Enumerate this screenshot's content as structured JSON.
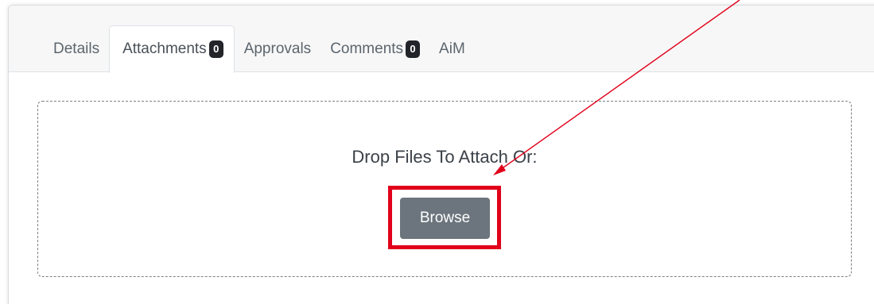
{
  "tabs": [
    {
      "label": "Details",
      "badge": null,
      "active": false
    },
    {
      "label": "Attachments",
      "badge": "0",
      "active": true
    },
    {
      "label": "Approvals",
      "badge": null,
      "active": false
    },
    {
      "label": "Comments",
      "badge": "0",
      "active": false
    },
    {
      "label": "AiM",
      "badge": null,
      "active": false
    }
  ],
  "dropzone": {
    "text": "Drop Files To Attach Or:",
    "browse_label": "Browse"
  },
  "colors": {
    "annotation_red": "#e1001a",
    "button_gray": "#6c757d",
    "badge_dark": "#212529"
  }
}
